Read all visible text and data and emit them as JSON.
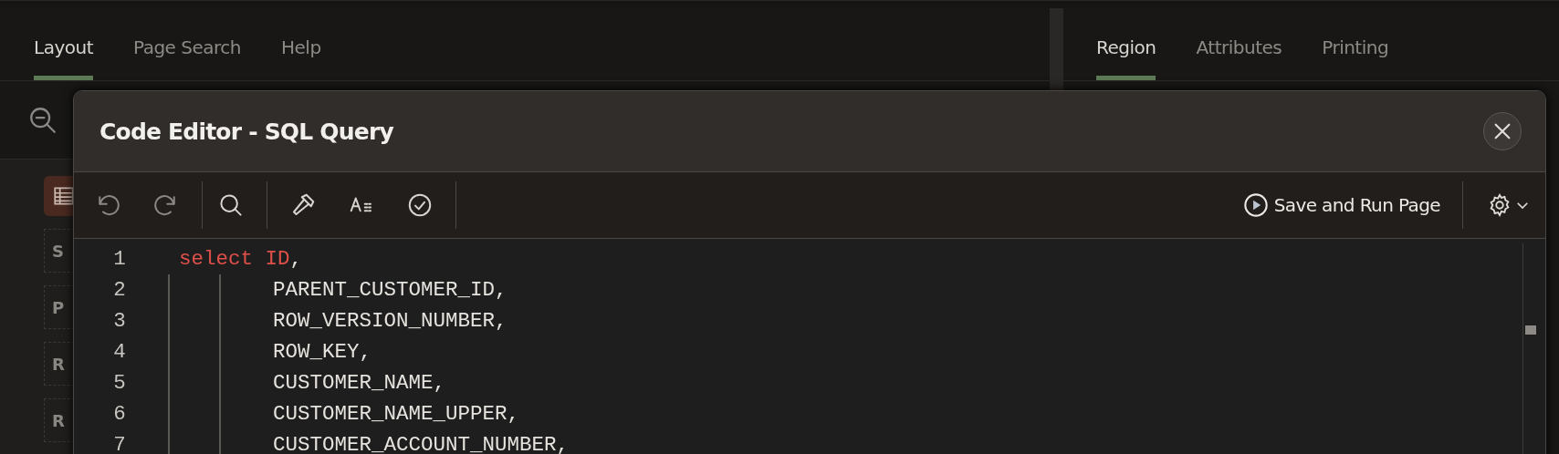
{
  "left_pane": {
    "tabs": [
      {
        "label": "Layout",
        "selected": true
      },
      {
        "label": "Page Search",
        "selected": false
      },
      {
        "label": "Help",
        "selected": false
      }
    ],
    "region_items": [
      "S",
      "P",
      "R",
      "R"
    ]
  },
  "right_pane": {
    "tabs": [
      {
        "label": "Region",
        "selected": true
      },
      {
        "label": "Attributes",
        "selected": false
      },
      {
        "label": "Printing",
        "selected": false
      }
    ]
  },
  "dialog": {
    "title": "Code Editor - SQL Query",
    "run_button": "Save and Run Page",
    "code_lines": [
      {
        "number": "1",
        "kind": "start",
        "tokens": [
          {
            "text": "select ID",
            "kind": "keyword"
          },
          {
            "text": ",",
            "kind": "plain"
          }
        ]
      },
      {
        "number": "2",
        "kind": "continuation",
        "tokens": [
          {
            "text": "PARENT_CUSTOMER_ID,",
            "kind": "plain"
          }
        ]
      },
      {
        "number": "3",
        "kind": "continuation",
        "tokens": [
          {
            "text": "ROW_VERSION_NUMBER,",
            "kind": "plain"
          }
        ]
      },
      {
        "number": "4",
        "kind": "continuation",
        "tokens": [
          {
            "text": "ROW_KEY,",
            "kind": "plain"
          }
        ]
      },
      {
        "number": "5",
        "kind": "continuation",
        "tokens": [
          {
            "text": "CUSTOMER_NAME,",
            "kind": "plain"
          }
        ]
      },
      {
        "number": "6",
        "kind": "continuation",
        "tokens": [
          {
            "text": "CUSTOMER_NAME_UPPER,",
            "kind": "plain"
          }
        ]
      },
      {
        "number": "7",
        "kind": "continuation",
        "tokens": [
          {
            "text": "CUSTOMER_ACCOUNT_NUMBER,",
            "kind": "plain"
          }
        ]
      }
    ]
  }
}
